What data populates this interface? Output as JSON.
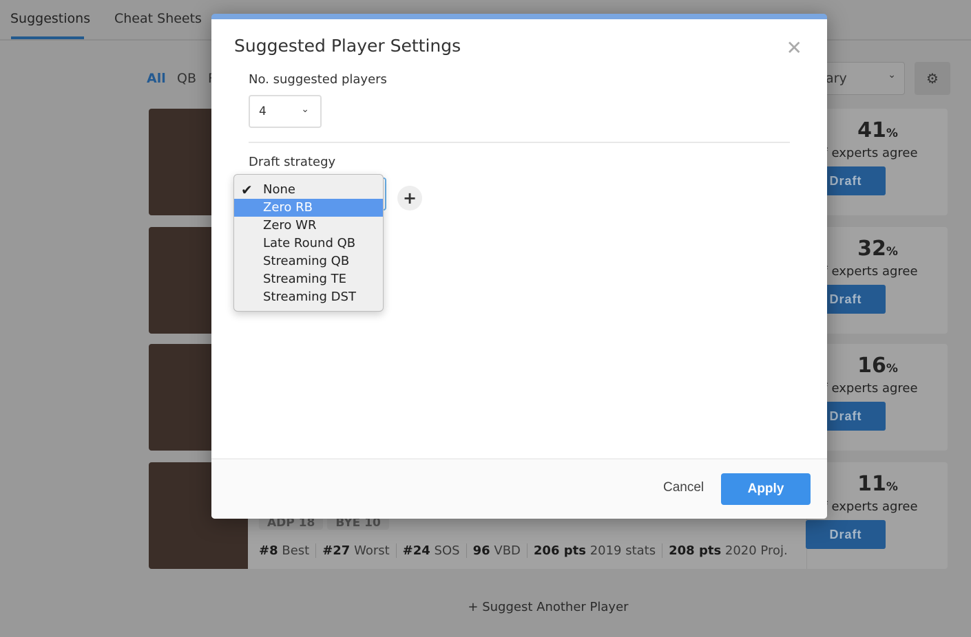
{
  "tabs": [
    {
      "label": "Suggestions"
    },
    {
      "label": "Cheat Sheets"
    }
  ],
  "positions": [
    {
      "label": "All"
    },
    {
      "label": "QB"
    },
    {
      "label": "R"
    }
  ],
  "sort_select": {
    "value": "ary"
  },
  "icons": {
    "settings": "gear-icon",
    "close": "close-icon",
    "add": "plus-icon",
    "check": "checkmark-icon",
    "dropdown": "chevron-down-icon"
  },
  "cards": [
    {
      "pct": "41",
      "agree": "of experts agree",
      "draft": "Draft"
    },
    {
      "pct": "32",
      "agree": "of experts agree",
      "draft": "Draft"
    },
    {
      "pct": "16",
      "agree": "of experts agree",
      "draft": "Draft"
    },
    {
      "pct": "11",
      "agree": "of experts agree",
      "draft": "Draft"
    }
  ],
  "pct_sign": "%",
  "last_card": {
    "tags": [
      "ADP 18",
      "BYE 10"
    ],
    "stats": [
      {
        "v": "#8",
        "l": "Best"
      },
      {
        "v": "#27",
        "l": "Worst"
      },
      {
        "v": "#24",
        "l": "SOS"
      },
      {
        "v": "96",
        "l": "VBD"
      },
      {
        "v": "206 pts",
        "l": "2019 stats"
      },
      {
        "v": "208 pts",
        "l": "2020 Proj."
      }
    ]
  },
  "suggest_another": "+ Suggest Another Player",
  "modal": {
    "title": "Suggested Player Settings",
    "num_label": "No. suggested players",
    "num_value": "4",
    "strategy_label": "Draft strategy",
    "options": [
      "None",
      "Zero RB",
      "Zero WR",
      "Late Round QB",
      "Streaming QB",
      "Streaming TE",
      "Streaming DST"
    ],
    "selected": "None",
    "highlighted": "Zero RB",
    "cancel": "Cancel",
    "apply": "Apply"
  },
  "colors": {
    "accent": "#3c91ea",
    "highlight": "#5b98ed",
    "modal_top": "#7aa6e0"
  }
}
